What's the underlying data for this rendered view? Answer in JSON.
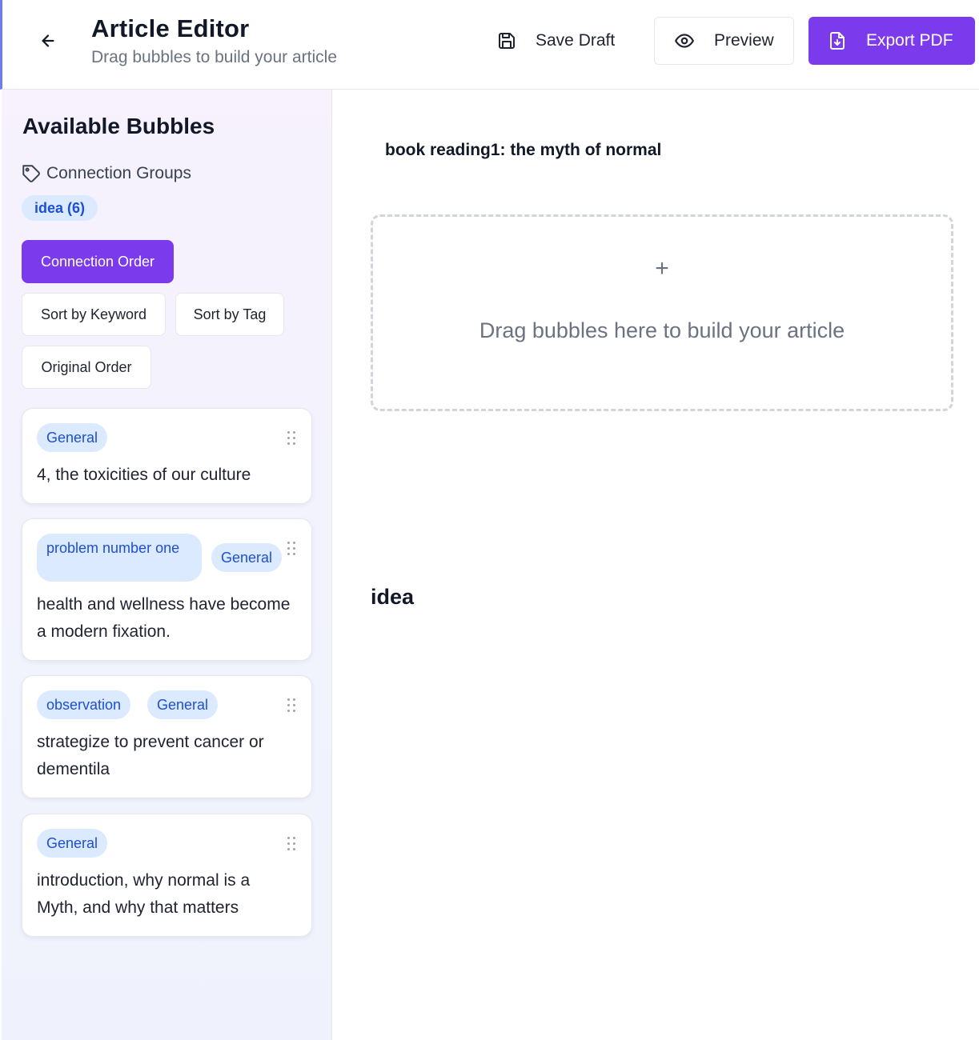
{
  "header": {
    "title": "Article Editor",
    "subtitle": "Drag bubbles to build your article",
    "save_label": "Save Draft",
    "preview_label": "Preview",
    "export_label": "Export PDF",
    "accent_color": "#7c3aed"
  },
  "sidebar": {
    "title": "Available Bubbles",
    "connection_groups_label": "Connection Groups",
    "groups": [
      {
        "label": "idea (6)"
      }
    ],
    "sort_buttons": {
      "connection_order": "Connection Order",
      "keyword": "Sort by Keyword",
      "tag": "Sort by Tag",
      "original": "Original Order",
      "active": "Connection Order"
    },
    "bubbles": [
      {
        "tags": [
          "General"
        ],
        "text": "4, the toxicities of our culture"
      },
      {
        "tags": [
          "problem number one",
          "General"
        ],
        "text": "health and wellness have become a modern fixation."
      },
      {
        "tags": [
          "observation",
          "General"
        ],
        "text": "strategize to prevent cancer or dementila"
      },
      {
        "tags": [
          "General"
        ],
        "text": "introduction, why normal is a Myth, and why that matters"
      }
    ]
  },
  "main": {
    "document_title": "book reading1: the myth of normal",
    "dropzone": {
      "icon": "+",
      "text": "Drag bubbles here to build your article"
    },
    "section_heading": "idea"
  },
  "icons": {
    "back": "arrow-left-icon",
    "save": "floppy-disk-icon",
    "preview": "eye-icon",
    "export": "file-download-icon",
    "groups": "tag-icon",
    "drag": "drag-handle-icon"
  }
}
